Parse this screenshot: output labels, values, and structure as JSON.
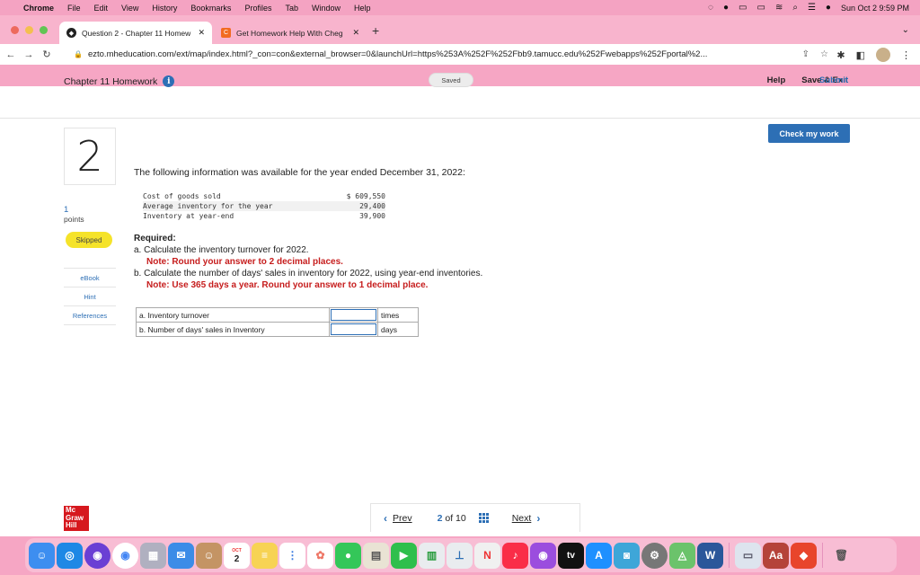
{
  "menubar": {
    "app": "Chrome",
    "items": [
      "File",
      "Edit",
      "View",
      "History",
      "Bookmarks",
      "Profiles",
      "Tab",
      "Window",
      "Help"
    ],
    "datetime": "Sun Oct 2  9:59 PM"
  },
  "tabs": [
    {
      "title": "Question 2 - Chapter 11 Homew",
      "active": true
    },
    {
      "title": "Get Homework Help With Cheg",
      "active": false
    }
  ],
  "address": {
    "url": "ezto.mheducation.com/ext/map/index.html?_con=con&external_browser=0&launchUrl=https%253A%252F%252Fbb9.tamucc.edu%252Fwebapps%252Fportal%2..."
  },
  "header": {
    "title": "Chapter 11 Homework",
    "saved": "Saved",
    "help": "Help",
    "save_exit": "Save & Exit",
    "submit": "Submit"
  },
  "check_work": "Check my work",
  "question": {
    "number": "2",
    "points_value": "1",
    "points_label": "points",
    "status": "Skipped",
    "resources": [
      "eBook",
      "Hint",
      "References"
    ],
    "intro": "The following information was available for the year ended December 31, 2022:",
    "data_rows": [
      {
        "label": "Cost of goods sold",
        "value": "$ 609,550"
      },
      {
        "label": "Average inventory for the year",
        "value": "29,400"
      },
      {
        "label": "Inventory at year-end",
        "value": "39,900"
      }
    ],
    "required_heading": "Required:",
    "part_a": "a. Calculate the inventory turnover for 2022.",
    "note_a": "Note: Round your answer to 2 decimal places.",
    "part_b": "b. Calculate the number of days' sales in inventory for 2022, using year-end inventories.",
    "note_b": "Note: Use 365 days a year. Round your answer to 1 decimal place.",
    "answers": [
      {
        "label": "a. Inventory turnover",
        "value": "",
        "unit": "times"
      },
      {
        "label": "b. Number of days' sales in Inventory",
        "value": "",
        "unit": "days"
      }
    ]
  },
  "logo_text": "Mc Graw Hill",
  "pager": {
    "prev": "Prev",
    "current": "2",
    "of": "of 10",
    "next": "Next"
  },
  "dock_icons": [
    "finder-icon",
    "safari-icon",
    "siri-icon",
    "chrome-icon",
    "launchpad-icon",
    "mail-icon",
    "contacts-icon",
    "calendar-icon",
    "notes-icon",
    "reminders-icon",
    "photos-icon",
    "messages-icon",
    "preview-icon",
    "facetime-icon",
    "numbers-icon",
    "keynote-icon",
    "news-icon",
    "music-icon",
    "podcasts-icon",
    "tv-icon",
    "appstore-icon",
    "ring-icon",
    "system-preferences-icon",
    "maps-icon",
    "word-icon",
    "screenshot-icon",
    "dictionary-icon",
    "anydesk-icon",
    "trash-icon"
  ],
  "calendar_day": "2",
  "calendar_month": "OCT",
  "tv_label": "tv",
  "dict_label": "Aa"
}
